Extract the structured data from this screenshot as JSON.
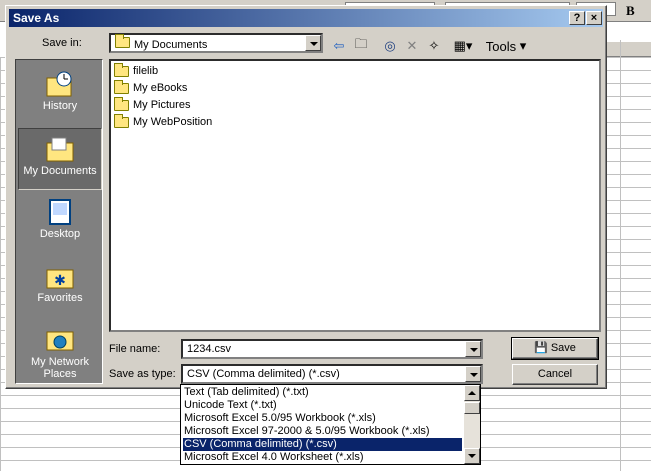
{
  "window": {
    "title": "Save As",
    "help_label": "?",
    "close_label": "×"
  },
  "background": {
    "bold_button": "B"
  },
  "toolbar": {
    "save_in_label": "Save in:",
    "save_in_value": "My Documents",
    "tools_label": "Tools"
  },
  "places": [
    {
      "label": "History",
      "icon": "history-icon"
    },
    {
      "label": "My Documents",
      "icon": "my-documents-icon"
    },
    {
      "label": "Desktop",
      "icon": "desktop-icon"
    },
    {
      "label": "Favorites",
      "icon": "favorites-icon"
    },
    {
      "label": "My Network Places",
      "icon": "network-places-icon"
    }
  ],
  "files": [
    "filelib",
    "My eBooks",
    "My Pictures",
    "My WebPosition"
  ],
  "form": {
    "file_name_label": "File name:",
    "file_name_value": "1234.csv",
    "save_as_type_label": "Save as type:",
    "save_as_type_value": "CSV (Comma delimited) (*.csv)"
  },
  "buttons": {
    "save": "Save",
    "cancel": "Cancel"
  },
  "type_options": [
    "Text (Tab delimited) (*.txt)",
    "Unicode Text (*.txt)",
    "Microsoft Excel 5.0/95 Workbook (*.xls)",
    "Microsoft Excel 97-2000 & 5.0/95 Workbook (*.xls)",
    "CSV (Comma delimited) (*.csv)",
    "Microsoft Excel 4.0 Worksheet (*.xls)"
  ],
  "selected_type_index": 4,
  "colors": {
    "title_start": "#0a246a",
    "title_end": "#a6caf0",
    "selection": "#0a246a"
  }
}
